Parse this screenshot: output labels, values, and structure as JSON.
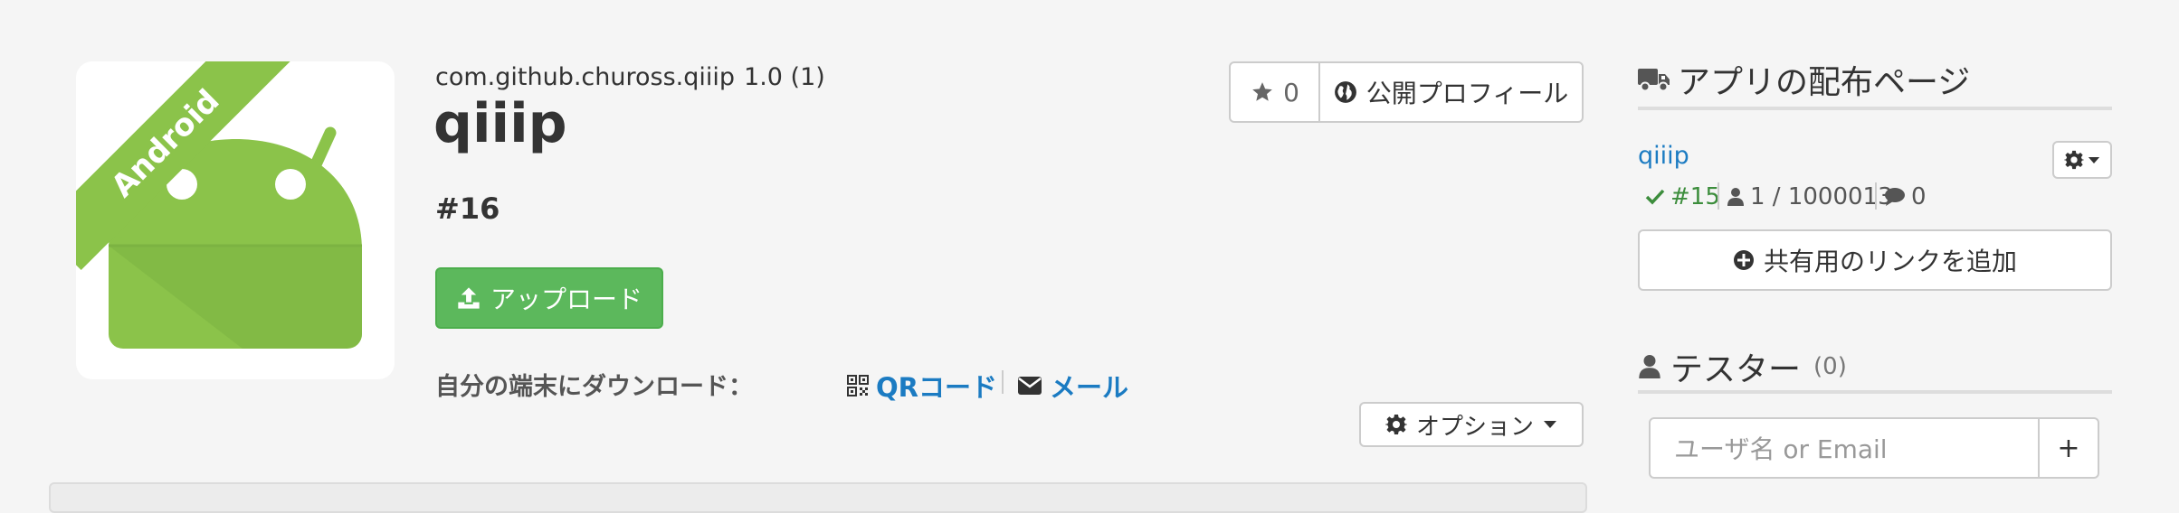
{
  "app": {
    "platform_badge": "Android",
    "package": "com.github.chuross.qiiip",
    "version": "1.0 (1)",
    "name": "qiiip",
    "build": "#16"
  },
  "actions": {
    "upload_label": "アップロード",
    "star_count": "0",
    "public_profile_label": "公開プロフィール",
    "options_label": "オプション"
  },
  "download": {
    "label": "自分の端末にダウンロード：",
    "qr_label": "QRコード",
    "mail_label": "メール"
  },
  "distribution": {
    "heading": "アプリの配布ページ",
    "page_name": "qiiip",
    "build": "#15",
    "installs": "1 / 1000013",
    "comments": "0",
    "add_link_label": "共有用のリンクを追加"
  },
  "testers": {
    "heading": "テスター",
    "count": "(0)",
    "input_placeholder": "ユーザ名 or Email",
    "add_label": "+"
  },
  "colors": {
    "primary_link": "#1b7bc2",
    "success": "#5cb85c",
    "android_green": "#8bc34a",
    "check_green": "#3c8d3c"
  },
  "icons": [
    "android-robot-icon",
    "upload-icon",
    "qr-code-icon",
    "envelope-icon",
    "star-icon",
    "globe-icon",
    "gear-icon",
    "caret-down-icon",
    "truck-icon",
    "check-icon",
    "user-icon",
    "comment-icon",
    "plus-circle-icon"
  ]
}
